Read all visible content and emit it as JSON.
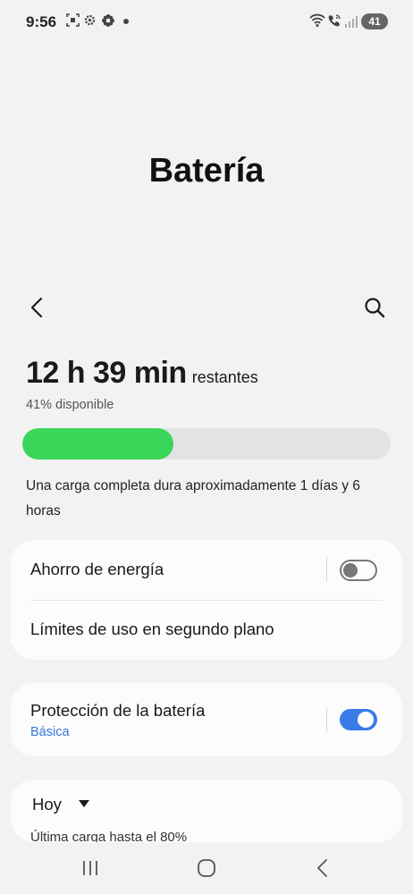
{
  "status_bar": {
    "time": "9:56",
    "icons": [
      "screenshot-icon",
      "gear-icon",
      "flower-icon",
      "dot-icon",
      "wifi-icon",
      "call-icon",
      "signal-icon"
    ],
    "battery_level": "41"
  },
  "header": {
    "title": "Batería"
  },
  "toolbar": {
    "back_icon": "chevron-left-icon",
    "search_icon": "search-icon"
  },
  "battery": {
    "time_remaining": "12 h 39 min",
    "remaining_label": "restantes",
    "available": "41% disponible",
    "level_fraction": 0.41,
    "bar_color": "#3ad65a",
    "full_charge_note": "Una carga completa dura aproximadamente 1 días y 6 horas"
  },
  "settings": {
    "power_saving": {
      "label": "Ahorro de energía",
      "enabled": false
    },
    "background_limits": {
      "label": "Límites de uso en segundo plano"
    },
    "battery_protection": {
      "label": "Protección de la batería",
      "value": "Básica",
      "enabled": true
    }
  },
  "usage": {
    "period": "Hoy",
    "last_charge": "Última carga hasta el 80%"
  },
  "colors": {
    "accent": "#3a7be8",
    "link": "#3478d8",
    "background": "#f2f2f2",
    "card": "#fcfcfc"
  },
  "nav": {
    "recents_icon": "recents-icon",
    "home_icon": "home-icon",
    "back_icon": "back-icon"
  }
}
